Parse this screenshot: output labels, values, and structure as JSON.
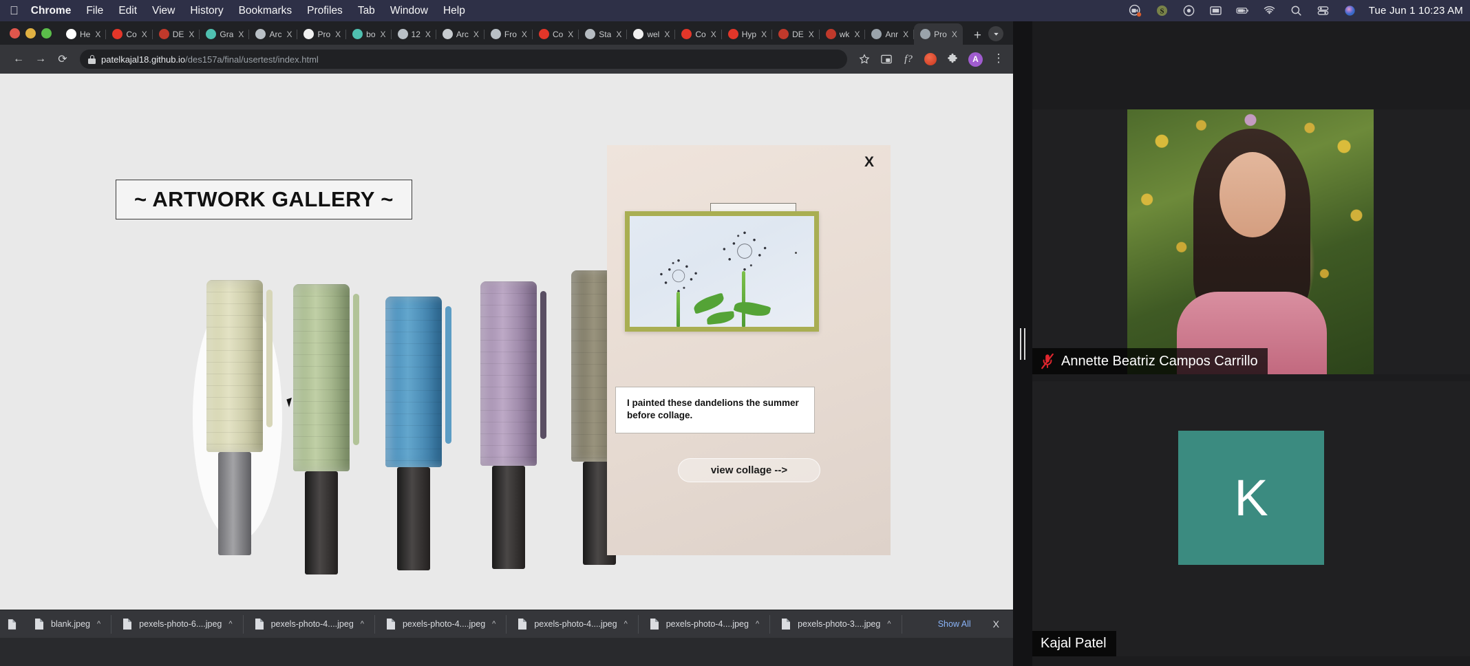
{
  "menubar": {
    "apple_icon": "apple-logo-icon",
    "items": [
      {
        "label": "Chrome",
        "bold": true
      },
      {
        "label": "File",
        "bold": false
      },
      {
        "label": "Edit",
        "bold": false
      },
      {
        "label": "View",
        "bold": false
      },
      {
        "label": "History",
        "bold": false
      },
      {
        "label": "Bookmarks",
        "bold": false
      },
      {
        "label": "Profiles",
        "bold": false
      },
      {
        "label": "Tab",
        "bold": false
      },
      {
        "label": "Window",
        "bold": false
      },
      {
        "label": "Help",
        "bold": false
      }
    ],
    "status_icons": [
      "zoom-meeting-icon",
      "dollar-sign-icon",
      "screen-record-icon",
      "display-icon",
      "battery-charging-icon",
      "wifi-icon",
      "spotlight-search-icon",
      "control-center-icon",
      "siri-icon"
    ],
    "clock": "Tue Jun 1  10:23 AM"
  },
  "browser": {
    "window_controls": [
      "close",
      "minimize",
      "zoom"
    ],
    "tabs": [
      {
        "title": "He",
        "favicon": "star-icon",
        "color": "#ffffff",
        "active": false
      },
      {
        "title": "Co",
        "favicon": "youtube-icon",
        "color": "#e33629",
        "active": false
      },
      {
        "title": "DE",
        "favicon": "drupal-icon",
        "color": "#c0392b",
        "active": false
      },
      {
        "title": "Gra",
        "favicon": "codepen-icon",
        "color": "#4fc0b0",
        "active": false
      },
      {
        "title": "Arc",
        "favicon": "link-icon",
        "color": "#b9c0c6",
        "active": false
      },
      {
        "title": "Pro",
        "favicon": "github-icon",
        "color": "#f0f0f0",
        "active": false
      },
      {
        "title": "bo",
        "favicon": "codepen-icon",
        "color": "#4fc0b0",
        "active": false
      },
      {
        "title": "12",
        "favicon": "link-icon",
        "color": "#b9c0c6",
        "active": false
      },
      {
        "title": "Arc",
        "favicon": "book-icon",
        "color": "#c8ccd0",
        "active": false
      },
      {
        "title": "Fro",
        "favicon": "link-icon",
        "color": "#b9c0c6",
        "active": false
      },
      {
        "title": "Co",
        "favicon": "youtube-icon",
        "color": "#e33629",
        "active": false
      },
      {
        "title": "Sta",
        "favicon": "stack-icon",
        "color": "#b6bcc2",
        "active": false
      },
      {
        "title": "wel",
        "favicon": "github-icon",
        "color": "#f0f0f0",
        "active": false
      },
      {
        "title": "Co",
        "favicon": "youtube-icon",
        "color": "#e33629",
        "active": false
      },
      {
        "title": "Hyp",
        "favicon": "youtube-icon",
        "color": "#e33629",
        "active": false
      },
      {
        "title": "DE",
        "favicon": "drupal-icon",
        "color": "#c0392b",
        "active": false
      },
      {
        "title": "wk",
        "favicon": "drupal-icon",
        "color": "#c0392b",
        "active": false
      },
      {
        "title": "Anr",
        "favicon": "globe-icon",
        "color": "#9aa3ab",
        "active": false
      },
      {
        "title": "Pro",
        "favicon": "globe-icon",
        "color": "#9aa3ab",
        "active": true
      }
    ],
    "new_tab_label": "+",
    "close_tab_label": "X",
    "toolbar": {
      "back_label": "←",
      "forward_label": "→",
      "reload_label": "⟳",
      "url_secure": "patelkajal18.github.io",
      "url_path": "/des157a/final/usertest/index.html",
      "right_icons": [
        "bookmark-star-icon",
        "picture-in-picture-icon",
        "fonts-extension-icon",
        "extension-red-icon",
        "extensions-puzzle-icon"
      ],
      "profile_initial": "A",
      "menu_label": "⋮"
    }
  },
  "page": {
    "gallery_title": "~ ARTWORK GALLERY ~",
    "background_image_alt": "row of pastel marker caps",
    "modal": {
      "close_label": "X",
      "artwork_alt": "framed dandelion painting on cream wall",
      "caption": "I painted these dandelions the summer before collage.",
      "button_label": "view collage -->"
    }
  },
  "downloads": {
    "items": [
      {
        "name": "blank.jpeg"
      },
      {
        "name": "pexels-photo-6....jpeg"
      },
      {
        "name": "pexels-photo-4....jpeg"
      },
      {
        "name": "pexels-photo-4....jpeg"
      },
      {
        "name": "pexels-photo-4....jpeg"
      },
      {
        "name": "pexels-photo-4....jpeg"
      },
      {
        "name": "pexels-photo-3....jpeg"
      }
    ],
    "caret_label": "^",
    "show_all_label": "Show All",
    "close_label": "X"
  },
  "zoom_panel": {
    "participants": [
      {
        "name": "Annette Beatriz Campos Carrillo",
        "muted": true,
        "type": "video",
        "video_alt": "woman in front of yellow flower wall"
      },
      {
        "name": "Kajal Patel",
        "muted": false,
        "type": "avatar",
        "initial": "K",
        "avatar_color": "#3b8b80"
      }
    ]
  }
}
